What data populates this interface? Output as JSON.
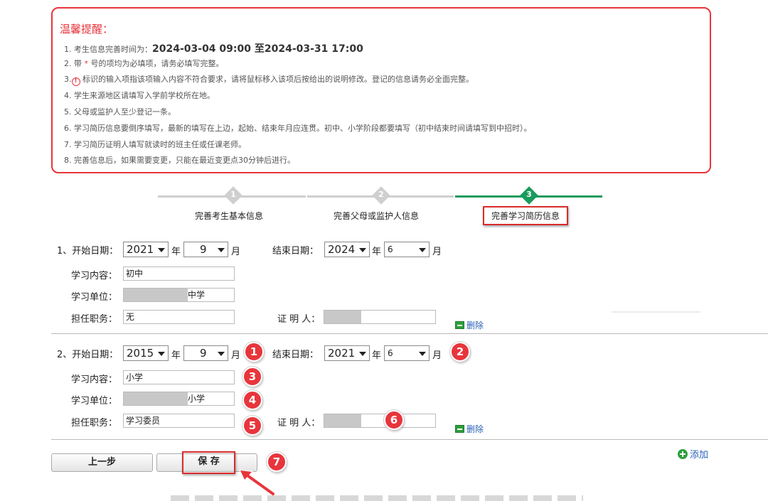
{
  "notice": {
    "title": "温馨提醒：",
    "item1_prefix": "1. 考生信息完善时间为：",
    "item1_time": "2024-03-04 09:00 至2024-03-31 17:00",
    "item2_a": "2. 带",
    "item2_star": "*",
    "item2_b": "号的项均为必填项，请务必填写完整。",
    "item3_num": "3.",
    "item3_icon": "!",
    "item3_text": "标识的输入项指该项输入内容不符合要求，请将鼠标移入该项后按给出的说明修改。登记的信息请务必全面完整。",
    "item4": "4. 学生来源地区请填写入学前学校所在地。",
    "item5": "5. 父母或监护人至少登记一条。",
    "item6": "6. 学习简历信息要倒序填写，最新的填写在上边，起始、结束年月应连贯。初中、小学阶段都要填写（初中结束时间请填写到中招时）。",
    "item7": "7. 学习简历证明人填写就读时的班主任或任课老师。",
    "item8": "8. 完善信息后，如果需要变更，只能在最近变更点30分钟后进行。"
  },
  "steps": [
    {
      "num": "1",
      "label": "完善考生基本信息"
    },
    {
      "num": "2",
      "label": "完善父母或监护人信息"
    },
    {
      "num": "3",
      "label": "完善学习简历信息"
    }
  ],
  "labels": {
    "start_date": "开始日期：",
    "end_date": "结束日期：",
    "year": "年",
    "month": "月",
    "content": "学习内容：",
    "unit": "学习单位：",
    "duty": "担任职务：",
    "witness": "证 明 人：",
    "delete": "删除"
  },
  "records": [
    {
      "index": "1、",
      "start_year": "2021",
      "start_month": "9",
      "end_year": "2024",
      "end_month": "6",
      "content": "初中",
      "unit_suffix": "中学",
      "duty": "无"
    },
    {
      "index": "2、",
      "start_year": "2015",
      "start_month": "9",
      "end_year": "2021",
      "end_month": "6",
      "content": "小学",
      "unit_suffix": "小学",
      "duty": "学习委员"
    }
  ],
  "badges": [
    "1",
    "2",
    "3",
    "4",
    "5",
    "6",
    "7"
  ],
  "buttons": {
    "prev": "上一步",
    "save": "保 存",
    "add": "添加"
  },
  "colors": {
    "alert_red": "#e8353c",
    "step_done": "#cfcfcf",
    "step_active": "#1a9a5c",
    "link_blue": "#2a62b8"
  }
}
